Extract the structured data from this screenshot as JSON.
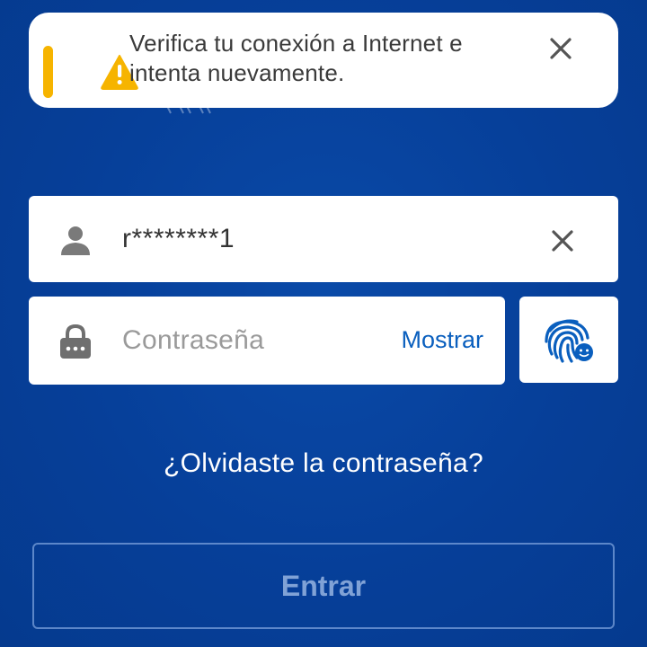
{
  "toast": {
    "message": "Verifica tu conexión a Internet e intenta nuevamente.",
    "accent_color": "#f6b400",
    "icon": "warning-icon",
    "close_icon": "close-icon"
  },
  "login": {
    "username": {
      "value": "r********1",
      "icon": "user-icon",
      "clear_icon": "close-icon"
    },
    "password": {
      "placeholder": "Contraseña",
      "value": "",
      "icon": "lock-icon",
      "show_label": "Mostrar"
    },
    "fingerprint": {
      "icon": "fingerprint-icon"
    },
    "forgot_label": "¿Olvidaste la contraseña?",
    "submit_label": "Entrar",
    "submit_enabled": false
  },
  "colors": {
    "background": "#063f99",
    "link": "#0a5fbe"
  }
}
